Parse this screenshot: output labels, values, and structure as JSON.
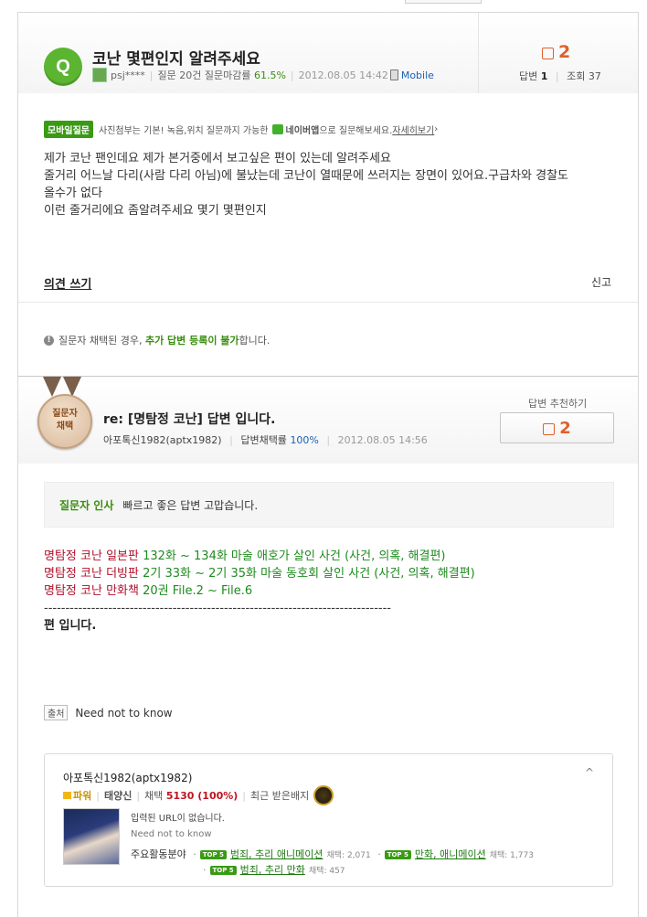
{
  "question": {
    "badge": "Q",
    "title": "코난 몇편인지 알려주세요",
    "user": "psj****",
    "question_count": "질문 20건",
    "closing_rate_label": "질문마감률",
    "closing_rate": "61.5%",
    "date": "2012.08.05 14:42",
    "via": "Mobile",
    "likes": "2",
    "answers_label": "답변",
    "answers": "1",
    "views_label": "조회",
    "views": "37",
    "mobile_badge": "모바일질문",
    "mobile_text": "사진첨부는 기본! 녹음,위치 질문까지 가능한",
    "naver_app": "네이버앱",
    "mobile_text2": "으로 질문해보세요.",
    "mobile_link": "자세히보기",
    "body": [
      "제가 코난 팬인데요 제가 본거중에서 보고싶은 편이 있는데 알려주세요",
      "줄거리 어느날 다리(사람 다리 아님)에 불났는데 코난이 열때문에 쓰러지는 장면이 있어요.구급차와 경찰도",
      "올수가 없다",
      "이런 줄거리에요 좀알려주세요 몇기 몇편인지"
    ],
    "opinion_link": "의견 쓰기",
    "report": "신고"
  },
  "notice": {
    "part1": "질문자 채택된 경우,",
    "strong": "추가 답변 등록이 불가",
    "part2": "합니다."
  },
  "answer": {
    "medal_line1": "질문자",
    "medal_line2": "채택",
    "title": "re: [명탐정 코난] 답변 입니다.",
    "user": "아포톡신1982(aptx1982)",
    "adopt_label": "답변채택률",
    "adopt_rate": "100%",
    "date": "2012.08.05 14:56",
    "recommend_label": "답변 추천하기",
    "recommend_count": "2",
    "thanks_label": "질문자 인사",
    "thanks_text": "빠르고 좋은 답변 고맙습니다.",
    "lines": [
      {
        "title": "명탐정 코난 일본판",
        "text": "132화 ~ 134화 마술 애호가 살인 사건 (사건, 의혹, 해결편)"
      },
      {
        "title": "명탐정 코난 더빙판",
        "text": "2기 33화 ~ 2기 35화 마술 동호회 살인 사건 (사건, 의혹, 해결편)"
      },
      {
        "title": "명탐정 코난 만화책",
        "text": "20권 File.2 ~ File.6"
      }
    ],
    "dashes": "---------------------------------------------------------------------------------",
    "ending": "편 입니다.",
    "source_badge": "출처",
    "source_text": "Need not to know"
  },
  "profile": {
    "name": "아포톡신1982(aptx1982)",
    "caret": "^",
    "power_label": "파워",
    "rank": "태양신",
    "adopt_label": "채택",
    "adopt_count": "5130 (100%)",
    "badge_label": "최근 받은배지",
    "url_text": "입력된 URL이 없습니다.",
    "intro": "Need not to know",
    "field_label": "주요활동분야",
    "top5": "TOP 5",
    "fields": [
      {
        "name": "범죄, 추리 애니메이션",
        "count": "채택: 2,071"
      },
      {
        "name": "만화, 애니메이션",
        "count": "채택: 1,773"
      },
      {
        "name": "범죄, 추리 만화",
        "count": "채택: 457"
      }
    ]
  },
  "colors": {
    "accent_green": "#3a8e10",
    "like_orange": "#e0602a",
    "title_red": "#b0102a"
  }
}
